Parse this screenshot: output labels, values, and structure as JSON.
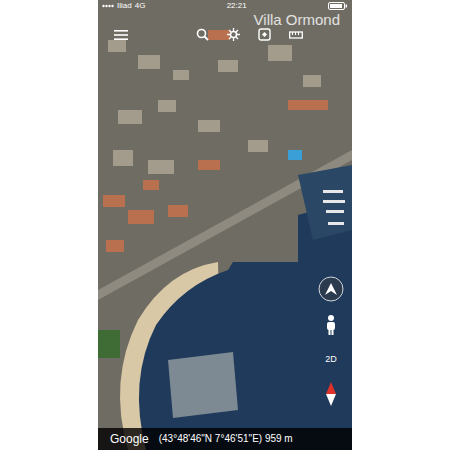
{
  "status_bar": {
    "carrier": "Iliad",
    "network": "4G",
    "time": "22:21"
  },
  "place_title": "Villa Ormond",
  "map_controls": {
    "view_mode": "2D"
  },
  "footer": {
    "brand": "Google",
    "coordinates": "(43°48'46\"N 7°46'51\"E) 959 m"
  }
}
